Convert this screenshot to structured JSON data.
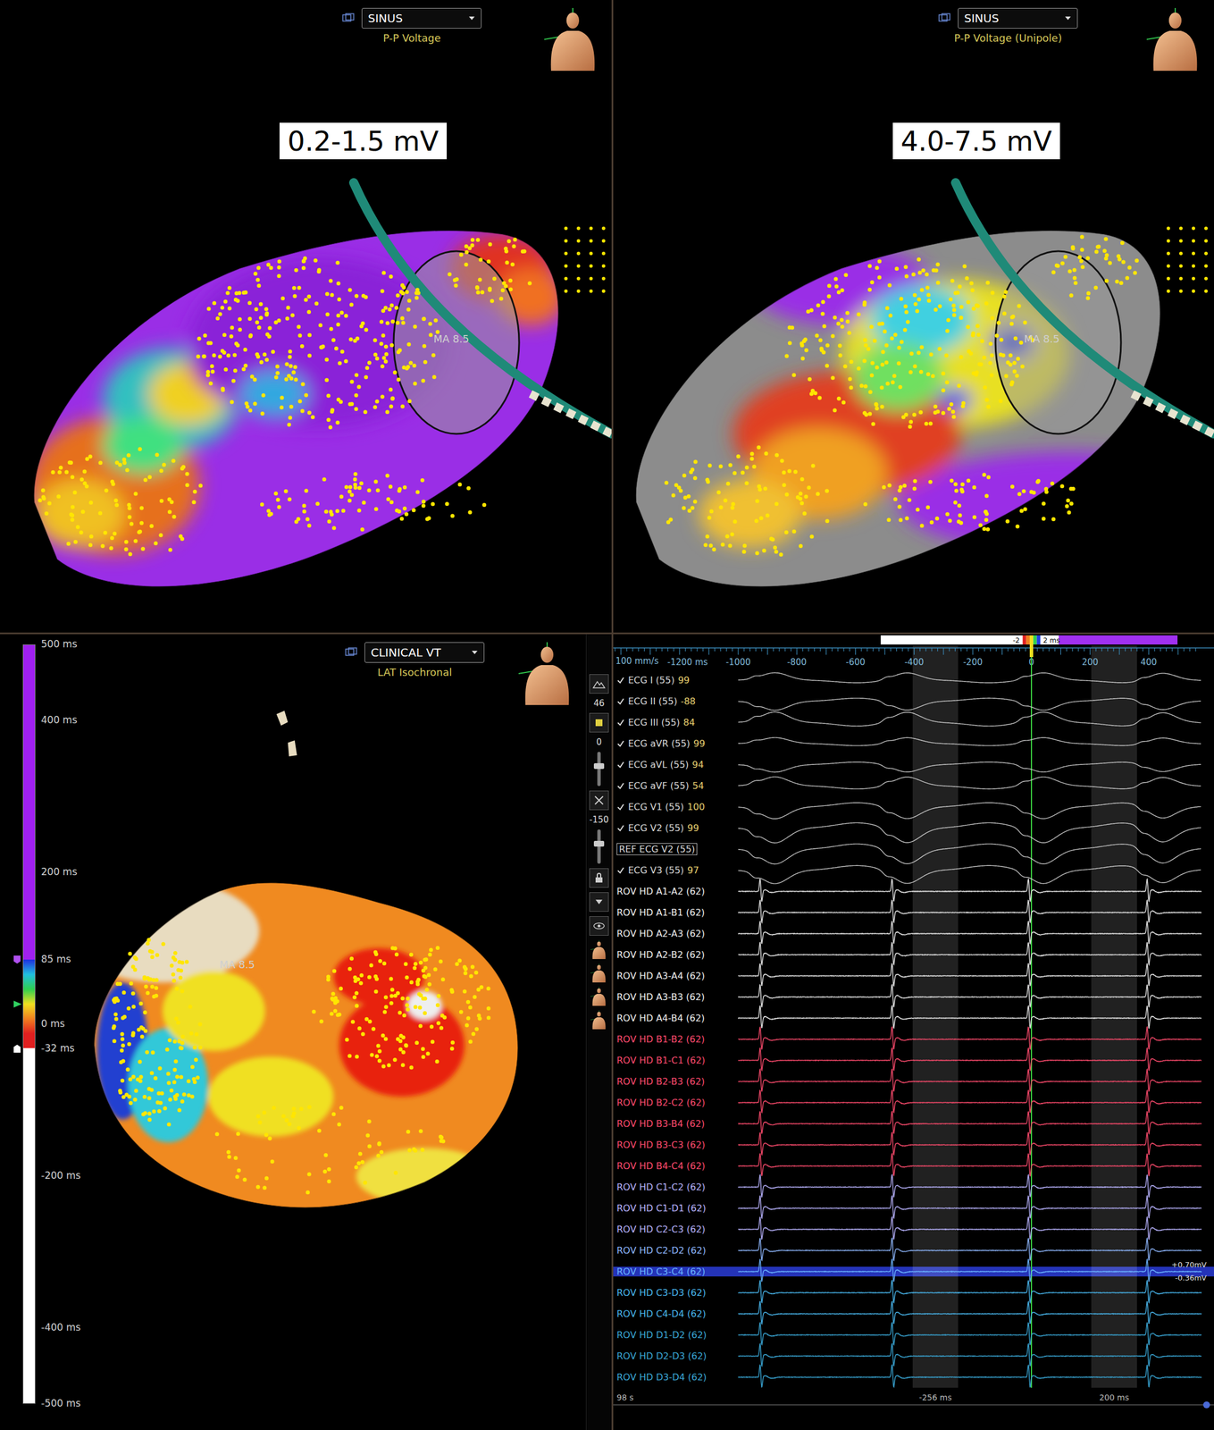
{
  "voltage_maps": [
    {
      "view": "SINUS",
      "map_type": "P-P Voltage",
      "range_label": "0.2-1.5 mV",
      "annotation": "MA 8.5",
      "style": "bipolar"
    },
    {
      "view": "SINUS",
      "map_type": "P-P Voltage (Unipole)",
      "range_label": "4.0-7.5 mV",
      "annotation": "MA 8.5",
      "style": "unipolar"
    }
  ],
  "lat_map": {
    "view": "CLINICAL VT",
    "map_type": "LAT Isochronal",
    "annotation": "MA 8.5",
    "scale": {
      "max": 500,
      "min": -500,
      "window_high": 85,
      "window_low": -32,
      "ticks": [
        {
          "label": "500 ms",
          "value": 500
        },
        {
          "label": "400 ms",
          "value": 400
        },
        {
          "label": "200 ms",
          "value": 200
        },
        {
          "label": "85 ms",
          "value": 85
        },
        {
          "label": "0 ms",
          "value": 0
        },
        {
          "label": "-32 ms",
          "value": -32
        },
        {
          "label": "-200 ms",
          "value": -200
        },
        {
          "label": "-400 ms",
          "value": -400
        },
        {
          "label": "-500 ms",
          "value": -500
        }
      ]
    },
    "toolbar": {
      "point_count": "46",
      "upper_slider": "0",
      "lower_slider": "-150"
    }
  },
  "tracing": {
    "speed": "100 mm/s",
    "ruler": [
      {
        "label": "-1200 ms",
        "value": -1200
      },
      {
        "label": "-1000",
        "value": -1000
      },
      {
        "label": "-800",
        "value": -800
      },
      {
        "label": "-600",
        "value": -600
      },
      {
        "label": "-400",
        "value": -400
      },
      {
        "label": "-200",
        "value": -200
      },
      {
        "label": "0",
        "value": 0
      },
      {
        "label": "200",
        "value": 200
      },
      {
        "label": "400",
        "value": 400
      }
    ],
    "window_indicator": {
      "low": "-2",
      "high": "2 ms"
    },
    "beats": [
      -925,
      -475,
      -10,
      395
    ],
    "windows": [
      {
        "label": "-256 ms",
        "start": -405,
        "end": -250
      },
      {
        "label": "200 ms",
        "start": 204,
        "end": 360
      }
    ],
    "time": "98 s",
    "amplitude": {
      "upper": "+0.70mV",
      "lower": "-0.36mV"
    },
    "channels": [
      {
        "kind": "ecg",
        "label": "ECG I (55)",
        "value": "99",
        "checked": true,
        "polarity": 0.5,
        "color": "#d8d8d8",
        "selected": false
      },
      {
        "kind": "ecg",
        "label": "ECG II (55)",
        "value": "-88",
        "checked": true,
        "polarity": -0.6,
        "color": "#d8d8d8",
        "selected": false
      },
      {
        "kind": "ecg",
        "label": "ECG III (55)",
        "value": "84",
        "checked": true,
        "polarity": 0.7,
        "color": "#d8d8d8",
        "selected": false
      },
      {
        "kind": "ecg",
        "label": "ECG aVR (55)",
        "value": "99",
        "checked": true,
        "polarity": 0.4,
        "color": "#d8d8d8",
        "selected": false
      },
      {
        "kind": "ecg",
        "label": "ECG aVL (55)",
        "value": "94",
        "checked": true,
        "polarity": -0.5,
        "color": "#d8d8d8",
        "selected": false
      },
      {
        "kind": "ecg",
        "label": "ECG aVF (55)",
        "value": "54",
        "checked": true,
        "polarity": 0.6,
        "color": "#d8d8d8",
        "selected": false
      },
      {
        "kind": "ecg",
        "label": "ECG V1 (55)",
        "value": "100",
        "checked": true,
        "polarity": -0.8,
        "color": "#d8d8d8",
        "selected": false
      },
      {
        "kind": "ecg",
        "label": "ECG V2 (55)",
        "value": "99",
        "checked": true,
        "polarity": -1,
        "color": "#d8d8d8",
        "selected": false
      },
      {
        "kind": "ref",
        "label": "REF ECG V2 (55)",
        "value": "",
        "checked": false,
        "polarity": -1,
        "color": "#d8d8d8",
        "selected": false
      },
      {
        "kind": "ecg",
        "label": "ECG V3 (55)",
        "value": "97",
        "checked": true,
        "polarity": -0.9,
        "color": "#d8d8d8",
        "selected": false
      },
      {
        "kind": "rov",
        "label": "ROV HD A1-A2 (62)",
        "color": "#f0f0f0",
        "selected": false
      },
      {
        "kind": "rov",
        "label": "ROV HD A1-B1 (62)",
        "color": "#f0f0f0",
        "selected": false
      },
      {
        "kind": "rov",
        "label": "ROV HD A2-A3 (62)",
        "color": "#f0f0f0",
        "selected": false
      },
      {
        "kind": "rov",
        "label": "ROV HD A2-B2 (62)",
        "color": "#f0f0f0",
        "selected": false
      },
      {
        "kind": "rov",
        "label": "ROV HD A3-A4 (62)",
        "color": "#f0f0f0",
        "selected": false
      },
      {
        "kind": "rov",
        "label": "ROV HD A3-B3 (62)",
        "color": "#f0f0f0",
        "selected": false
      },
      {
        "kind": "rov",
        "label": "ROV HD A4-B4 (62)",
        "color": "#f0f0f0",
        "selected": false
      },
      {
        "kind": "rov",
        "label": "ROV HD B1-B2 (62)",
        "color": "#ff4b6e",
        "selected": false
      },
      {
        "kind": "rov",
        "label": "ROV HD B1-C1 (62)",
        "color": "#ff4b6e",
        "selected": false
      },
      {
        "kind": "rov",
        "label": "ROV HD B2-B3 (62)",
        "color": "#ff4b6e",
        "selected": false
      },
      {
        "kind": "rov",
        "label": "ROV HD B2-C2 (62)",
        "color": "#ff4b6e",
        "selected": false
      },
      {
        "kind": "rov",
        "label": "ROV HD B3-B4 (62)",
        "color": "#ff4b6e",
        "selected": false
      },
      {
        "kind": "rov",
        "label": "ROV HD B3-C3 (62)",
        "color": "#ff4b6e",
        "selected": false
      },
      {
        "kind": "rov",
        "label": "ROV HD B4-C4 (62)",
        "color": "#ff4b6e",
        "selected": false
      },
      {
        "kind": "rov",
        "label": "ROV HD C1-C2 (62)",
        "color": "#b9b4ff",
        "selected": false
      },
      {
        "kind": "rov",
        "label": "ROV HD C1-D1 (62)",
        "color": "#b9b4ff",
        "selected": false
      },
      {
        "kind": "rov",
        "label": "ROV HD C2-C3 (62)",
        "color": "#b9b4ff",
        "selected": false
      },
      {
        "kind": "rov",
        "label": "ROV HD C2-D2 (62)",
        "color": "#8fb8ff",
        "selected": false
      },
      {
        "kind": "rov",
        "label": "ROV HD C3-C4 (62)",
        "color": "#6ab4ff",
        "selected": true
      },
      {
        "kind": "rov",
        "label": "ROV HD C3-D3 (62)",
        "color": "#49b8f0",
        "selected": false
      },
      {
        "kind": "rov",
        "label": "ROV HD C4-D4 (62)",
        "color": "#49b8f0",
        "selected": false
      },
      {
        "kind": "rov",
        "label": "ROV HD D1-D2 (62)",
        "color": "#3aa8d8",
        "selected": false
      },
      {
        "kind": "rov",
        "label": "ROV HD D2-D3 (62)",
        "color": "#3aa8d8",
        "selected": false
      },
      {
        "kind": "rov",
        "label": "ROV HD D3-D4 (62)",
        "color": "#3aa8d8",
        "selected": false
      }
    ]
  }
}
